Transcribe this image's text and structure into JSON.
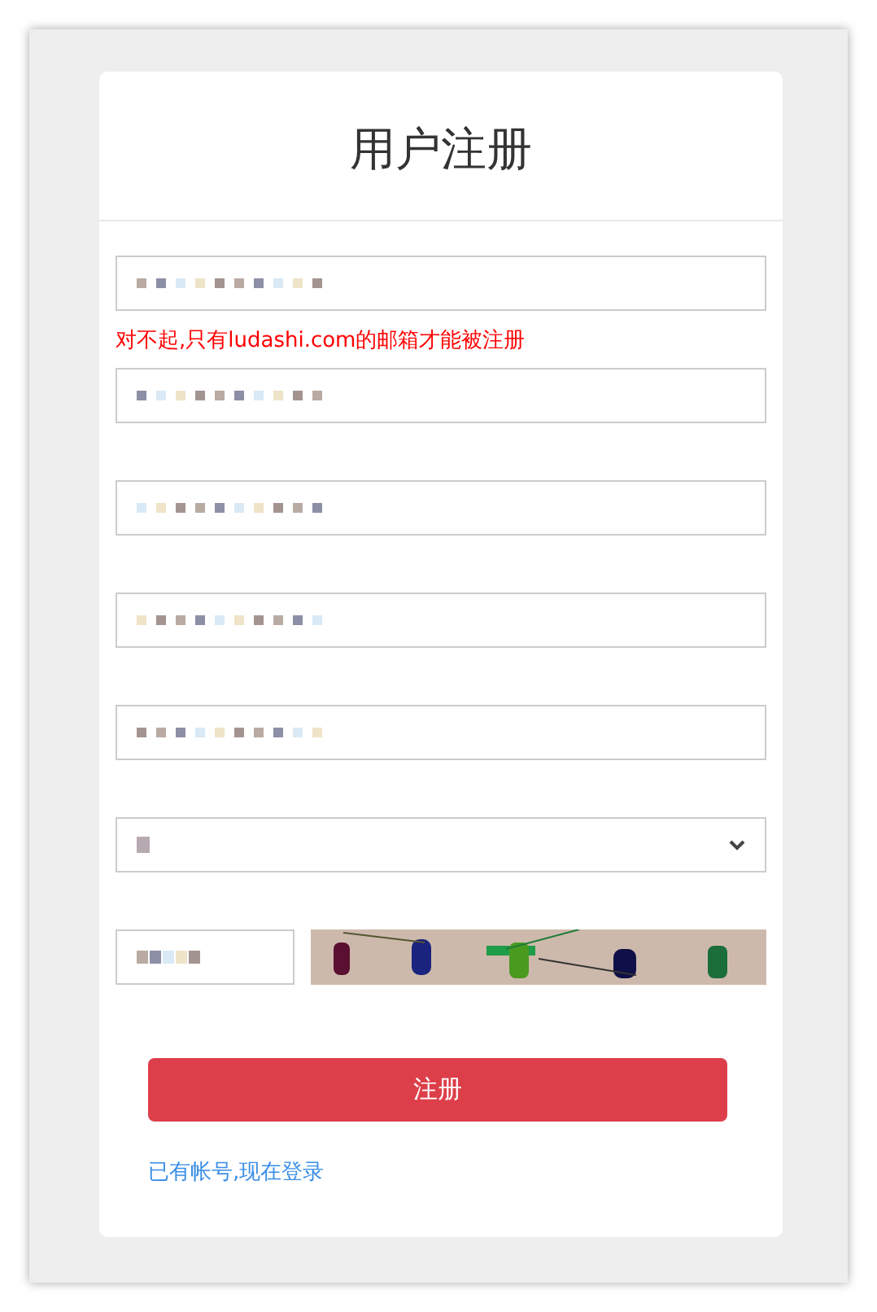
{
  "title": "用户注册",
  "fields": [
    {
      "kind": "input",
      "error": "对不起,只有ludashi.com的邮箱才能被注册"
    },
    {
      "kind": "input"
    },
    {
      "kind": "input"
    },
    {
      "kind": "input"
    },
    {
      "kind": "input"
    },
    {
      "kind": "select"
    }
  ],
  "submit": "注册",
  "login_link": "已有帐号,现在登录"
}
